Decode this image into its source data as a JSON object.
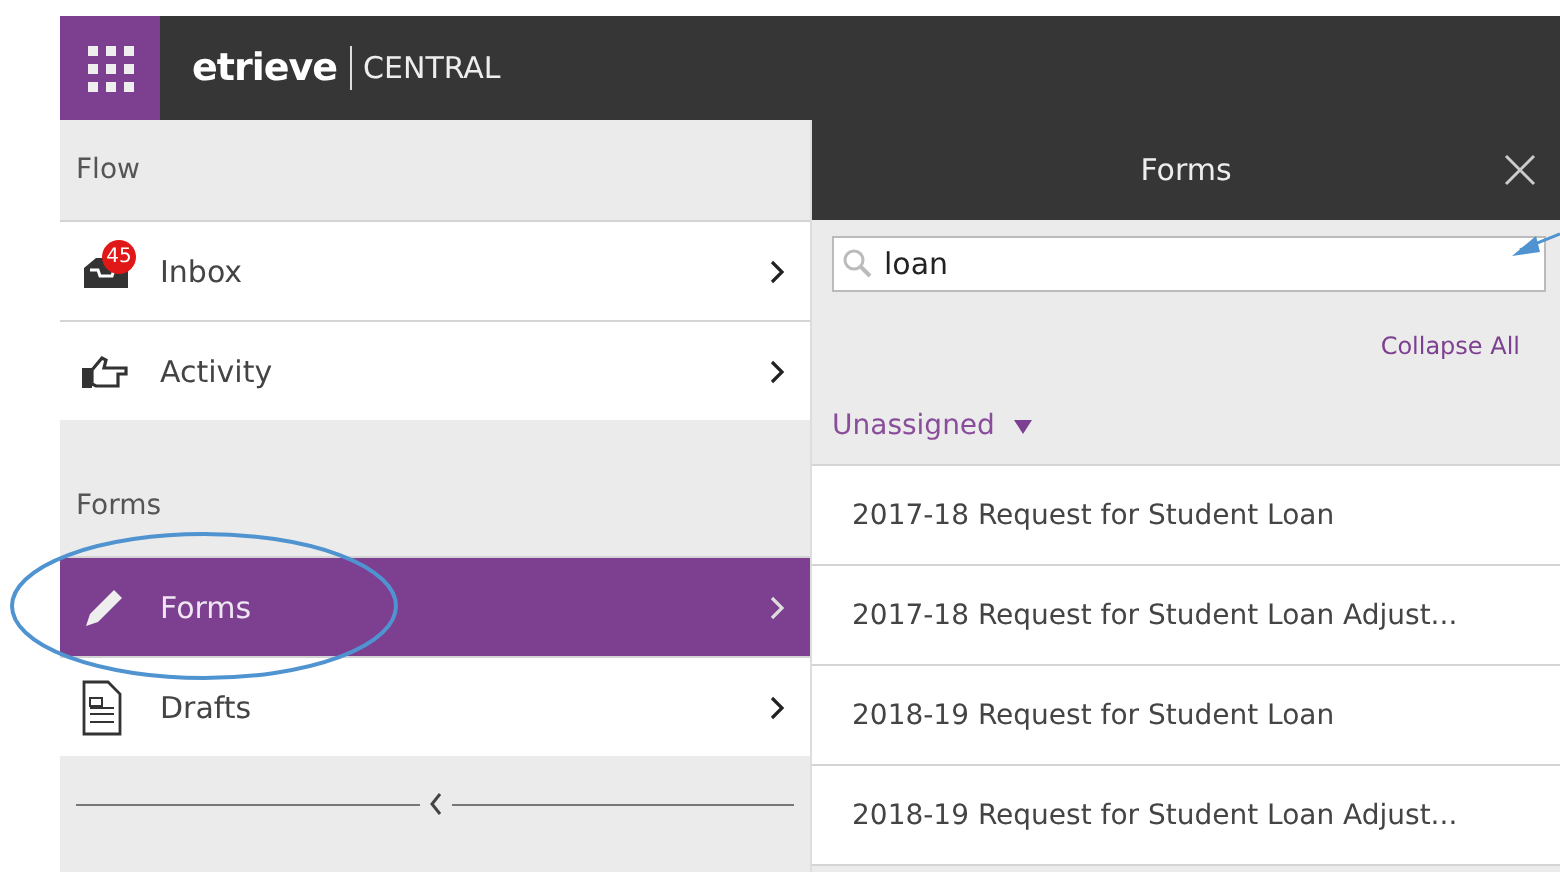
{
  "header": {
    "logo": "etrieve",
    "product": "CENTRAL"
  },
  "sidebar": {
    "sections": [
      {
        "label": "Flow",
        "items": [
          {
            "kind": "inbox",
            "label": "Inbox",
            "badge": "45",
            "selected": false
          },
          {
            "kind": "activity",
            "label": "Activity",
            "selected": false
          }
        ]
      },
      {
        "label": "Forms",
        "items": [
          {
            "kind": "forms",
            "label": "Forms",
            "selected": true
          },
          {
            "kind": "drafts",
            "label": "Drafts",
            "selected": false
          }
        ]
      }
    ]
  },
  "panel": {
    "title": "Forms",
    "search": {
      "value": "loan"
    },
    "collapse_all": "Collapse All",
    "group": {
      "label": "Unassigned",
      "expanded": true
    },
    "forms": [
      "2017-18 Request for Student Loan",
      "2017-18 Request for Student Loan Adjust...",
      "2018-19 Request for Student Loan",
      "2018-19 Request for Student Loan Adjust..."
    ]
  }
}
